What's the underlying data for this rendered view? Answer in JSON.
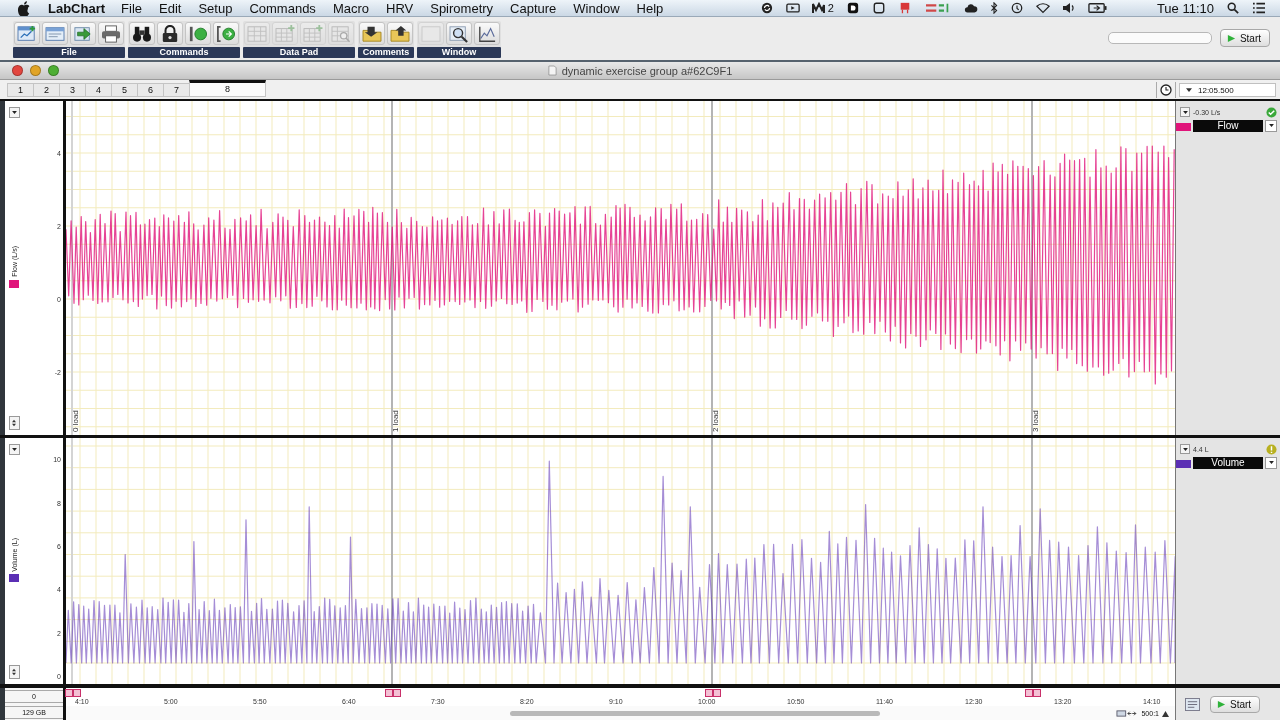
{
  "menubar": {
    "app": "LabChart",
    "menus": [
      "File",
      "Edit",
      "Setup",
      "Commands",
      "Macro",
      "HRV",
      "Spirometry",
      "Capture",
      "Window",
      "Help"
    ],
    "badge": "2",
    "clock": "Tue 11:10"
  },
  "toolbar": {
    "groups": [
      {
        "label": "File",
        "tools": [
          {
            "kind": "new",
            "disabled": false
          },
          {
            "kind": "open",
            "disabled": false
          },
          {
            "kind": "export",
            "disabled": false
          },
          {
            "kind": "print",
            "disabled": false
          }
        ]
      },
      {
        "label": "Commands",
        "tools": [
          {
            "kind": "binoculars",
            "disabled": false
          },
          {
            "kind": "lock",
            "disabled": false
          },
          {
            "kind": "marker",
            "disabled": false
          },
          {
            "kind": "marker-go",
            "disabled": false
          }
        ]
      },
      {
        "label": "Data Pad",
        "tools": [
          {
            "kind": "table",
            "disabled": true
          },
          {
            "kind": "table-add",
            "disabled": true
          },
          {
            "kind": "table-add",
            "disabled": true
          },
          {
            "kind": "table-view",
            "disabled": true
          }
        ]
      },
      {
        "label": "Comments",
        "tools": [
          {
            "kind": "folder-down",
            "disabled": false
          },
          {
            "kind": "folder-up",
            "disabled": false
          }
        ]
      },
      {
        "label": "Window",
        "tools": [
          {
            "kind": "blank",
            "disabled": true
          },
          {
            "kind": "zoom",
            "disabled": false
          },
          {
            "kind": "chart",
            "disabled": false
          }
        ]
      }
    ],
    "start_button": "Start"
  },
  "document": {
    "title": "dynamic exercise group a#62C9F1",
    "pages": [
      {
        "label": "1",
        "selected": false
      },
      {
        "label": "2",
        "selected": false
      },
      {
        "label": "3",
        "selected": false
      },
      {
        "label": "4",
        "selected": false
      },
      {
        "label": "5",
        "selected": false
      },
      {
        "label": "6",
        "selected": false
      },
      {
        "label": "7",
        "selected": false
      },
      {
        "label": "8",
        "selected": true
      }
    ],
    "time_display": "12:05.500"
  },
  "channels": [
    {
      "name": "Flow",
      "axis_label": "Flow (L/s)",
      "reading": "-0.30 L/s",
      "color": "#e0147a",
      "warning": false,
      "yticks": [
        "4",
        "2",
        "0",
        "-2"
      ]
    },
    {
      "name": "Volume",
      "axis_label": "Volume (L)",
      "reading": "4.4 L",
      "color": "#5b2fb4",
      "warning": true,
      "yticks": [
        "10",
        "8",
        "6",
        "4",
        "2",
        "0"
      ]
    }
  ],
  "comments": [
    "0 load",
    "1 load",
    "2 load",
    "3 load"
  ],
  "time_axis": {
    "readout": "0",
    "disk": "129 GB",
    "ticks": [
      "4:10",
      "5:00",
      "5:50",
      "6:40",
      "7:30",
      "8:20",
      "9:10",
      "10:00",
      "10:50",
      "11:40",
      "12:30",
      "13:20",
      "14:10"
    ],
    "zoom": "500:1",
    "start_button": "Start"
  }
}
